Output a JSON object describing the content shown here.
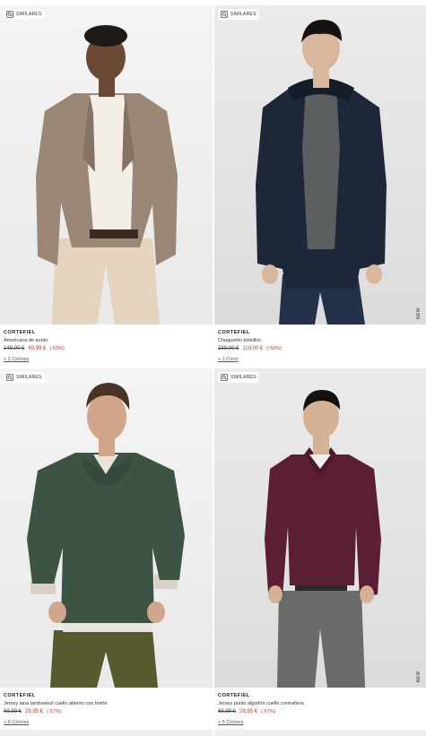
{
  "products": [
    {
      "badge": "SIMILARES",
      "brand": "CORTEFIEL",
      "name": "Americana de punto",
      "old_price": "149,00 €",
      "price": "69,99 €",
      "discount": "(-53%)",
      "colors": "+ 2 Colores",
      "new_tag": "",
      "palette": {
        "bg": "#f2f2f2",
        "top": "#9a8776",
        "inner": "#f3efe6",
        "bottom": "#e4d3bd",
        "skin": "#6b4a35"
      }
    },
    {
      "badge": "SIMILARES",
      "brand": "CORTEFIEL",
      "name": "Chaquetón bolsillos",
      "old_price": "239,00 €",
      "price": "119,00 €",
      "discount": "(-50%)",
      "colors": "+ 1 Color",
      "new_tag": "NEW",
      "palette": {
        "bg": "#e8e8e8",
        "top": "#1d2737",
        "inner": "#5b5f60",
        "bottom": "#23304a",
        "skin": "#d9b79c"
      }
    },
    {
      "badge": "SIMILARES",
      "brand": "CORTEFIEL",
      "name": "Jersey lana lambswool cuello abierto con botón",
      "old_price": "69,99 €",
      "price": "29,95 €",
      "discount": "(-57%)",
      "colors": "+ 6 Colores",
      "new_tag": "",
      "palette": {
        "bg": "#f2f2f2",
        "top": "#3d5445",
        "inner": "#e9e4dc",
        "bottom": "#565a2c",
        "skin": "#d2a68a"
      }
    },
    {
      "badge": "SIMILARES",
      "brand": "CORTEFIEL",
      "name": "Jersey punto algodón cuello cremallera",
      "old_price": "69,99 €",
      "price": "29,95 €",
      "discount": "(-57%)",
      "colors": "+ 5 Colores",
      "new_tag": "NEW",
      "palette": {
        "bg": "#e6e6e6",
        "top": "#5a1f35",
        "inner": "#eeeef2",
        "bottom": "#6a6a68",
        "skin": "#d5b295"
      }
    }
  ]
}
